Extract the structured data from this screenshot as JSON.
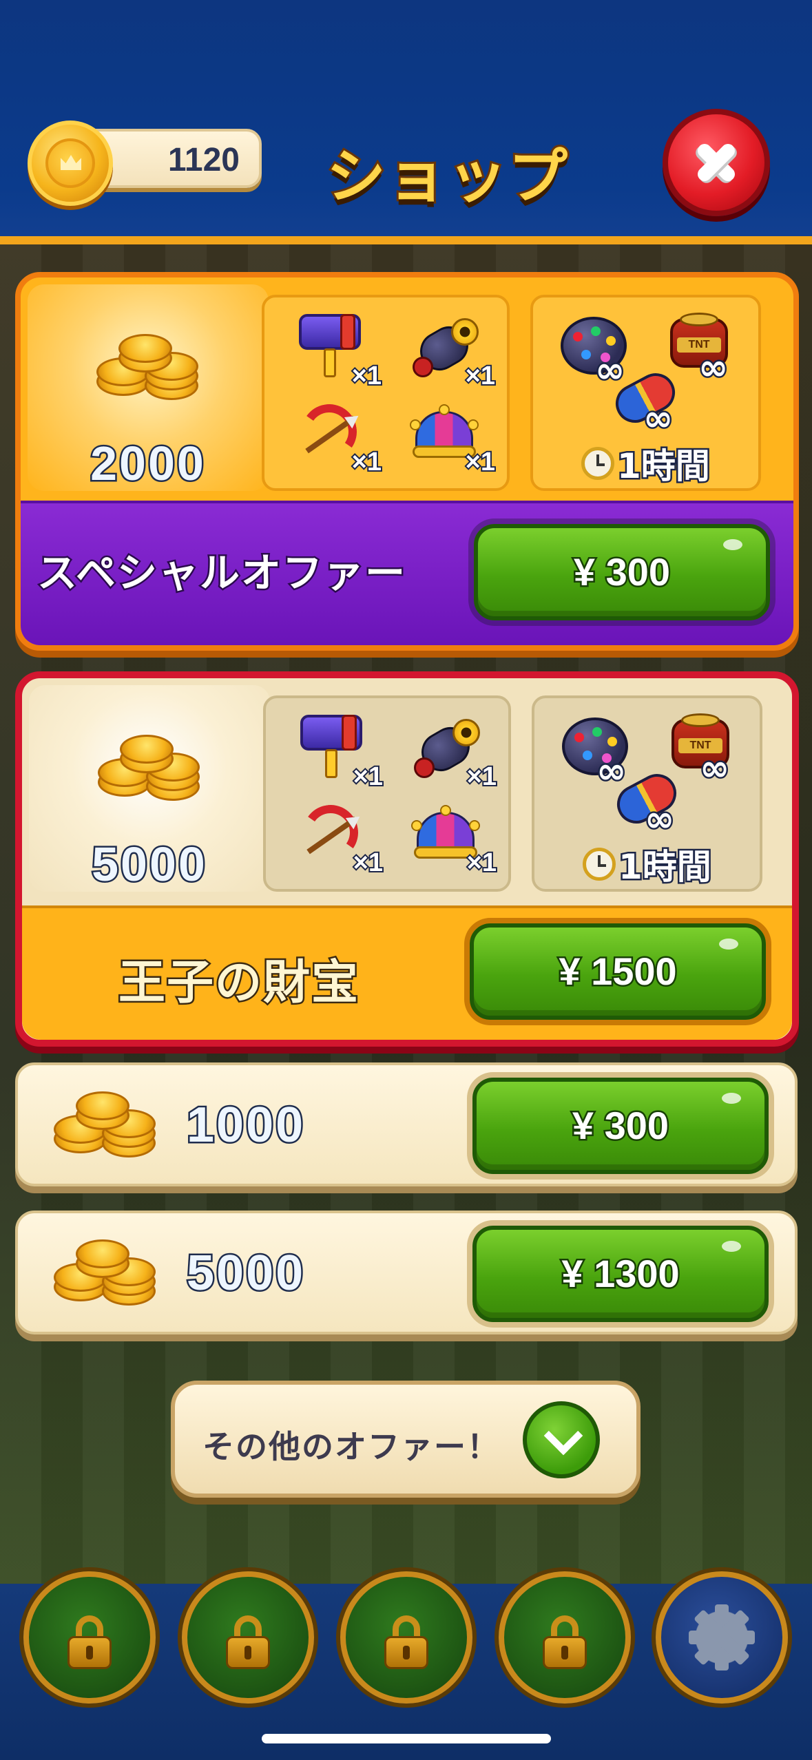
{
  "header": {
    "title": "ショップ",
    "coin_balance": "1120",
    "close_label": "close"
  },
  "offers": [
    {
      "name": "スペシャルオファー",
      "coins": "2000",
      "items": [
        {
          "icon": "hammer-icon",
          "count": "×1"
        },
        {
          "icon": "cannon-icon",
          "count": "×1"
        },
        {
          "icon": "bow-icon",
          "count": "×1"
        },
        {
          "icon": "jester-hat-icon",
          "count": "×1"
        }
      ],
      "boosters": [
        {
          "icon": "disco-ball-icon",
          "count": "∞"
        },
        {
          "icon": "tnt-icon",
          "count": "∞"
        },
        {
          "icon": "rocket-icon",
          "count": "∞"
        }
      ],
      "duration": "1時間",
      "price": "¥ 300",
      "accent": "#7a1fc8"
    },
    {
      "name": "王子の財宝",
      "coins": "5000",
      "items": [
        {
          "icon": "hammer-icon",
          "count": "×1"
        },
        {
          "icon": "cannon-icon",
          "count": "×1"
        },
        {
          "icon": "bow-icon",
          "count": "×1"
        },
        {
          "icon": "jester-hat-icon",
          "count": "×1"
        }
      ],
      "boosters": [
        {
          "icon": "disco-ball-icon",
          "count": "∞"
        },
        {
          "icon": "tnt-icon",
          "count": "∞"
        },
        {
          "icon": "rocket-icon",
          "count": "∞"
        }
      ],
      "duration": "1時間",
      "price": "¥ 1500",
      "accent": "#d3162f"
    }
  ],
  "coin_packs": [
    {
      "amount": "1000",
      "price": "¥ 300"
    },
    {
      "amount": "5000",
      "price": "¥ 1300"
    }
  ],
  "more_offers": {
    "label": "その他のオファー！"
  },
  "tnt_label": "TNT",
  "bottom_nav": {
    "slots": [
      "lock-icon",
      "lock-icon",
      "lock-icon",
      "lock-icon",
      "gear-icon"
    ]
  },
  "colors": {
    "header_bg": "#0b3b8c",
    "buy_green": "#4aa40e",
    "close_red": "#e31c26",
    "gold": "#f6b51c"
  }
}
